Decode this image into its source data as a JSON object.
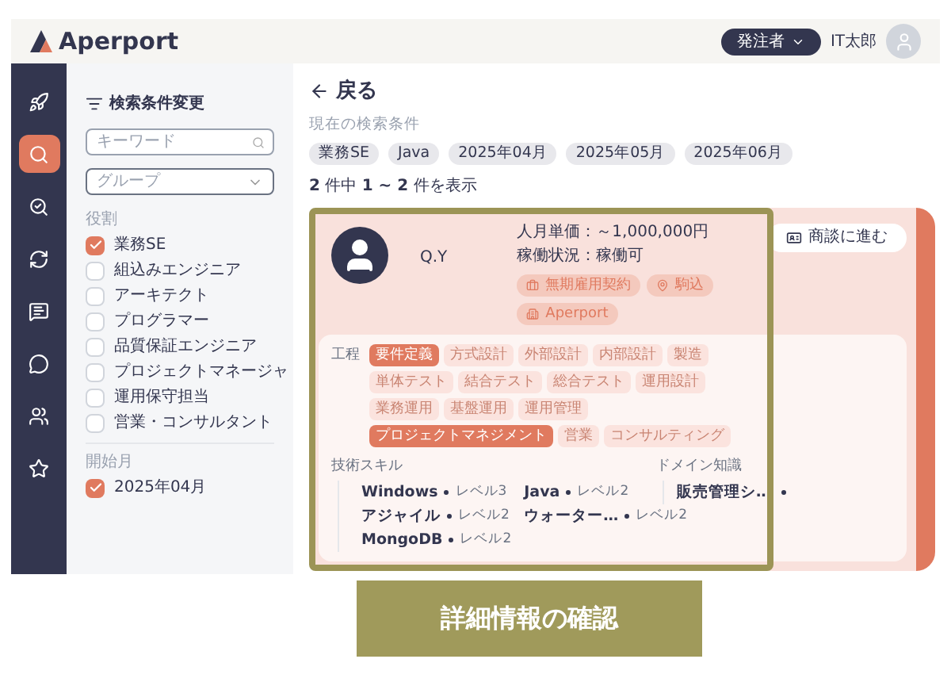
{
  "header": {
    "logo": "Aperport",
    "role_button": "発注者",
    "user_name": "IT太郎"
  },
  "nav": [
    {
      "kind": "rocket",
      "selected": false
    },
    {
      "kind": "search",
      "selected": true
    },
    {
      "kind": "people-search",
      "selected": false
    },
    {
      "kind": "exchange",
      "selected": false
    },
    {
      "kind": "star-board",
      "selected": false
    },
    {
      "kind": "chat",
      "selected": false
    },
    {
      "kind": "group",
      "selected": false
    },
    {
      "kind": "star",
      "selected": false
    }
  ],
  "filter": {
    "title": "検索条件変更",
    "keyword_placeholder": "キーワード",
    "group_placeholder": "グループ",
    "role_label": "役割",
    "roles": [
      {
        "label": "業務SE",
        "checked": true
      },
      {
        "label": "組込みエンジニア",
        "checked": false
      },
      {
        "label": "アーキテクト",
        "checked": false
      },
      {
        "label": "プログラマー",
        "checked": false
      },
      {
        "label": "品質保証エンジニア",
        "checked": false
      },
      {
        "label": "プロジェクトマネージャ",
        "checked": false
      },
      {
        "label": "運用保守担当",
        "checked": false
      },
      {
        "label": "営業・コンサルタント",
        "checked": false
      }
    ],
    "month_label": "開始月",
    "months": [
      {
        "label": "2025年04月",
        "checked": true
      }
    ]
  },
  "main": {
    "back": "戻る",
    "conditions_label": "現在の検索条件",
    "conditions": [
      "業務SE",
      "Java",
      "2025年04月",
      "2025年05月",
      "2025年06月"
    ],
    "result_count": "**2** 件中 **1 ~ 2** 件を表示"
  },
  "card": {
    "name": "Q.Y",
    "price": "人月単価：～1,000,000円",
    "status": "稼働状況：稼働可",
    "tags": [
      {
        "kind": "contract",
        "label": "無期雇用契約"
      },
      {
        "kind": "location",
        "label": "駒込"
      },
      {
        "kind": "company",
        "label": "Aperport"
      }
    ],
    "action": "商談に進む",
    "process_label": "工程",
    "processes": [
      {
        "label": "要件定義",
        "selected": true
      },
      {
        "label": "方式設計",
        "selected": false
      },
      {
        "label": "外部設計",
        "selected": false
      },
      {
        "label": "内部設計",
        "selected": false
      },
      {
        "label": "製造",
        "selected": false
      },
      {
        "label": "単体テスト",
        "selected": false
      },
      {
        "label": "結合テスト",
        "selected": false
      },
      {
        "label": "総合テスト",
        "selected": false
      },
      {
        "label": "運用設計",
        "selected": false
      },
      {
        "label": "業務運用",
        "selected": false
      },
      {
        "label": "基盤運用",
        "selected": false
      },
      {
        "label": "運用管理",
        "selected": false
      },
      {
        "label": "プロジェクトマネジメント",
        "selected": true
      },
      {
        "label": "営業",
        "selected": false
      },
      {
        "label": "コンサルティング",
        "selected": false
      }
    ],
    "tech_label": "技術スキル",
    "tech_skills": [
      {
        "name": "Windows",
        "level": "レベル3"
      },
      {
        "name": "Java",
        "level": "レベル2"
      },
      {
        "name": "アジャイル",
        "level": "レベル2"
      },
      {
        "name": "ウォーター…",
        "level": "レベル2"
      },
      {
        "name": "MongoDB",
        "level": "レベル2"
      }
    ],
    "domain_label": "ドメイン知識",
    "domain_skills": [
      {
        "name": "販売管理シ…"
      }
    ]
  },
  "caption": "詳細情報の確認"
}
